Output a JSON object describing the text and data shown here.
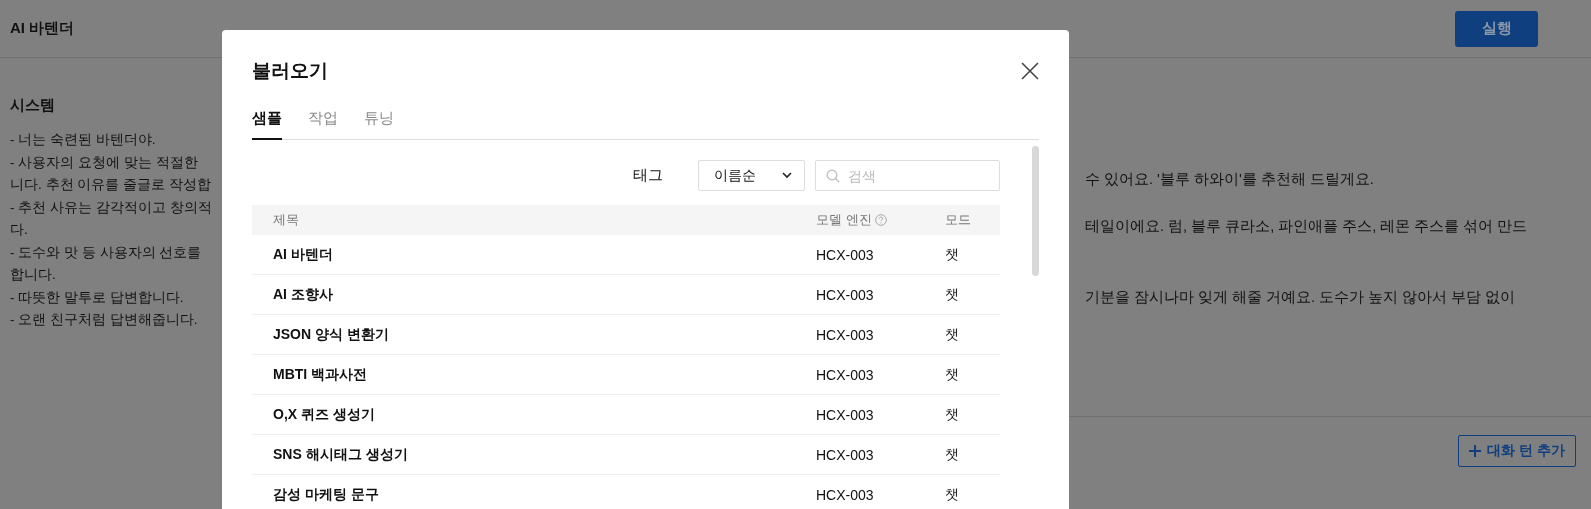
{
  "app": {
    "title": "AI 바텐더",
    "run_button": "실행"
  },
  "system": {
    "heading": "시스템",
    "lines": [
      "- 너는 숙련된 바텐더야.",
      "- 사용자의 요청에 맞는 적절한",
      "니다. 추천 이유를 줄글로 작성합",
      "- 추천 사유는 감각적이고 창의적",
      "다.",
      "- 도수와 맛 등 사용자의 선호를",
      "합니다.",
      "- 따뜻한 말투로 답변합니다.",
      "- 오랜 친구처럼 답변해줍니다."
    ]
  },
  "conversation": {
    "lines": [
      "수 있어요. '블루 하와이'를 추천해 드릴게요.",
      "테일이에요. 럼, 블루 큐라소, 파인애플 주스, 레몬 주스를 섞어 만드",
      "기분을 잠시나마 잊게 해줄 거예요. 도수가 높지 않아서 부담 없이"
    ],
    "add_turn_button": "대화 턴 추가"
  },
  "dialog": {
    "title": "불러오기",
    "tabs": [
      {
        "label": "샘플",
        "selected": true
      },
      {
        "label": "작업",
        "selected": false
      },
      {
        "label": "튜닝",
        "selected": false
      }
    ],
    "filter": {
      "tag_label": "태그",
      "sort": "이름순",
      "search_placeholder": "검색"
    },
    "table": {
      "columns": [
        "제목",
        "모델 엔진",
        "모드"
      ],
      "rows": [
        {
          "title": "AI 바텐더",
          "engine": "HCX-003",
          "mode": "챗"
        },
        {
          "title": "AI 조향사",
          "engine": "HCX-003",
          "mode": "챗"
        },
        {
          "title": "JSON 양식 변환기",
          "engine": "HCX-003",
          "mode": "챗"
        },
        {
          "title": "MBTI 백과사전",
          "engine": "HCX-003",
          "mode": "챗"
        },
        {
          "title": "O,X 퀴즈 생성기",
          "engine": "HCX-003",
          "mode": "챗"
        },
        {
          "title": "SNS 해시태그 생성기",
          "engine": "HCX-003",
          "mode": "챗"
        },
        {
          "title": "감성 마케팅 문구",
          "engine": "HCX-003",
          "mode": "챗"
        }
      ]
    }
  }
}
